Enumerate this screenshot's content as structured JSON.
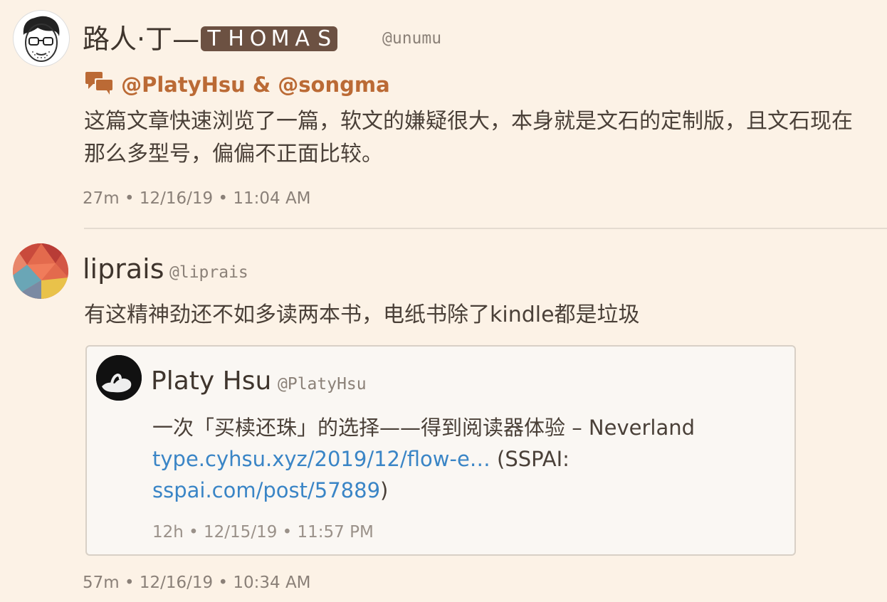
{
  "post1": {
    "name": "路人·丁—",
    "badge_letters": [
      "T",
      "H",
      "O",
      "M",
      "A",
      "S"
    ],
    "handle": "@unumu",
    "reply_to": "@PlatyHsu & @songma",
    "text": "这篇文章快速浏览了一篇，软文的嫌疑很大，本身就是文石的定制版，且文石现在那么多型号，偏偏不正面比较。",
    "meta": "27m • 12/16/19 • 11:04 AM"
  },
  "post2": {
    "name": "liprais",
    "handle": "@liprais",
    "text": "有这精神劲还不如多读两本书，电纸书除了kindle都是垃圾",
    "meta": "57m • 12/16/19 • 10:34 AM",
    "quote": {
      "name": "Platy Hsu",
      "handle": "@PlatyHsu",
      "title": "一次「买椟还珠」的选择——得到阅读器体验 – Neverland",
      "link1": "type.cyhsu.xyz/2019/12/flow-e…",
      "sspai_prefix": " (SSPAI: ",
      "link2": "sspai.com/post/57889",
      "sspai_suffix": ")",
      "meta": "12h • 12/15/19 • 11:57 PM"
    }
  },
  "colors": {
    "background": "#fcf2e6",
    "link": "#3a85c6",
    "reply": "#bb6a35",
    "badge": "#6c5142"
  },
  "icons": {
    "reply": "speech-bubbles-icon"
  }
}
